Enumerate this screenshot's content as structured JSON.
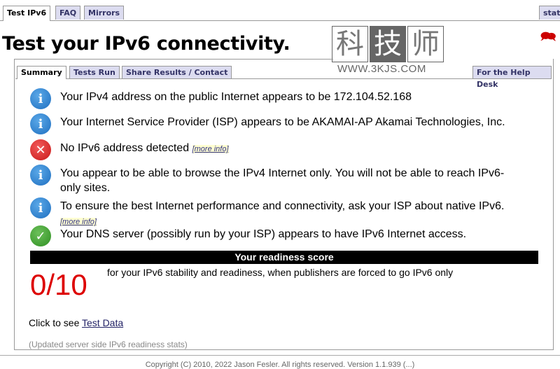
{
  "top_tabs": [
    {
      "label": "Test IPv6",
      "active": true
    },
    {
      "label": "FAQ"
    },
    {
      "label": "Mirrors"
    },
    {
      "label": "stats"
    }
  ],
  "title": "Test your IPv6 connectivity.",
  "logo": {
    "chars": [
      "科",
      "技",
      "师"
    ],
    "url": "WWW.3KJS.COM"
  },
  "sub_tabs": [
    {
      "label": "Summary",
      "active": true
    },
    {
      "label": "Tests Run"
    },
    {
      "label": "Share Results / Contact"
    }
  ],
  "help_desk_tab": "For the Help Desk",
  "results": [
    {
      "icon": "info-icon",
      "text": "Your IPv4 address on the public Internet appears to be 172.104.52.168"
    },
    {
      "icon": "info-icon",
      "text": "Your Internet Service Provider (ISP) appears to be AKAMAI-AP Akamai Technologies, Inc."
    },
    {
      "icon": "error-icon",
      "text": "No IPv6 address detected",
      "link": "[more info]"
    },
    {
      "icon": "info-icon",
      "text": "You appear to be able to browse the IPv4 Internet only. You will not be able to reach IPv6-only sites."
    },
    {
      "icon": "info-icon",
      "text": "To ensure the best Internet performance and connectivity, ask your ISP about native IPv6.",
      "link": "[more info]"
    },
    {
      "icon": "check-icon",
      "text": "Your DNS server (possibly run by your ISP) appears to have IPv6 Internet access."
    }
  ],
  "readiness": {
    "heading": "Your readiness score",
    "score": "0/10",
    "description": "for your IPv6 stability and readiness, when publishers are forced to go IPv6 only"
  },
  "test_data": {
    "prefix": "Click to see ",
    "link": "Test Data"
  },
  "updated_stats": "(Updated server side IPv6 readiness stats)",
  "footer": "Copyright (C) 2010, 2022 Jason Fesler. All rights reserved. Version 1.1.939 (...)",
  "colors": {
    "score": "#dd0000",
    "tab_bg": "#dcdcf0",
    "bar": "#000000"
  }
}
